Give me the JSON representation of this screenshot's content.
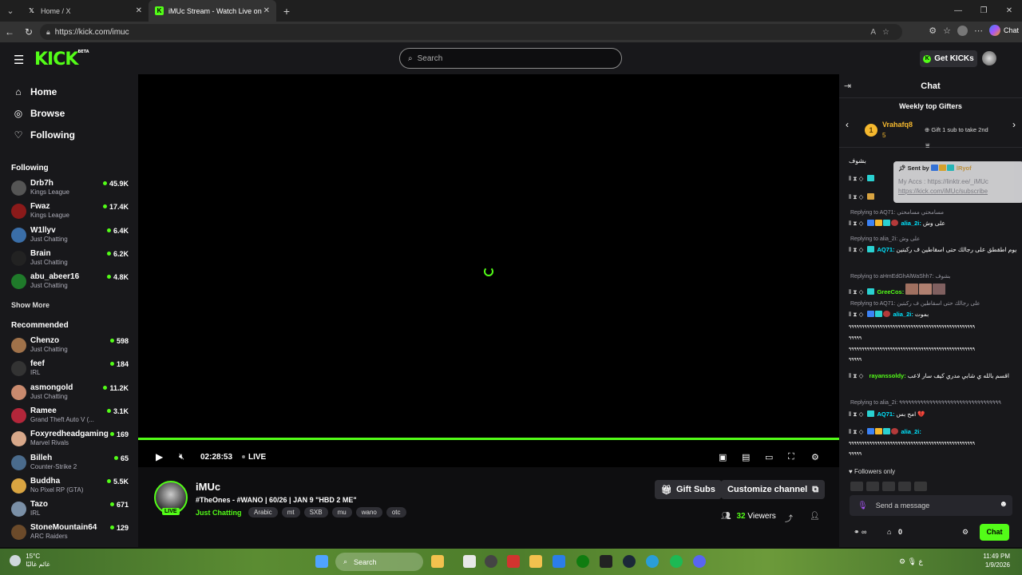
{
  "browser": {
    "tabs": [
      {
        "title": "Home / X",
        "icon": "x-icon",
        "active": false
      },
      {
        "title": "iMUc Stream - Watch Live on Kick",
        "icon": "kick-icon",
        "active": true
      }
    ],
    "url": "https://kick.com/imuc",
    "chat_label": "Chat"
  },
  "header": {
    "logo": "KICK",
    "logo_beta": "BETA",
    "search_placeholder": "Search",
    "get_kicks": "Get KICKs"
  },
  "sidebar": {
    "nav": [
      {
        "label": "Home",
        "icon": "home-icon"
      },
      {
        "label": "Browse",
        "icon": "compass-icon"
      },
      {
        "label": "Following",
        "icon": "heart-icon"
      }
    ],
    "following_title": "Following",
    "following": [
      {
        "name": "Drb7h",
        "category": "Kings League",
        "viewers": "45.9K",
        "color": "#555"
      },
      {
        "name": "Fwaz",
        "category": "Kings League",
        "viewers": "17.4K",
        "color": "#8b1a1a"
      },
      {
        "name": "W1llyv",
        "category": "Just Chatting",
        "viewers": "6.4K",
        "color": "#3a6ea8"
      },
      {
        "name": "Brain",
        "category": "Just Chatting",
        "viewers": "6.2K",
        "color": "#222"
      },
      {
        "name": "abu_abeer16",
        "category": "Just Chatting",
        "viewers": "4.8K",
        "color": "#1f7a2a"
      }
    ],
    "show_more": "Show More",
    "recommended_title": "Recommended",
    "recommended": [
      {
        "name": "Chenzo",
        "category": "Just Chatting",
        "viewers": "598",
        "color": "#a0724a"
      },
      {
        "name": "feef",
        "category": "IRL",
        "viewers": "184",
        "color": "#333"
      },
      {
        "name": "asmongold",
        "category": "Just Chatting",
        "viewers": "11.2K",
        "color": "#c98a6e"
      },
      {
        "name": "Ramee",
        "category": "Grand Theft Auto V (...",
        "viewers": "3.1K",
        "color": "#b3263a"
      },
      {
        "name": "Foxyredheadgaming",
        "category": "Marvel Rivals",
        "viewers": "169",
        "color": "#d8a88a"
      },
      {
        "name": "Billeh",
        "category": "Counter-Strike 2",
        "viewers": "65",
        "color": "#4a6b8c"
      },
      {
        "name": "Buddha",
        "category": "No Pixel RP (GTA)",
        "viewers": "5.5K",
        "color": "#d9a441"
      },
      {
        "name": "Tazo",
        "category": "IRL",
        "viewers": "671",
        "color": "#7a8fa6"
      },
      {
        "name": "StoneMountain64",
        "category": "ARC Raiders",
        "viewers": "129",
        "color": "#6b4a2a"
      }
    ]
  },
  "player": {
    "time": "02:28:53",
    "live": "LIVE",
    "progress": 1.0
  },
  "stream": {
    "name": "iMUc",
    "live_badge": "LIVE",
    "title": "#TheOnes - #WANO | 60/26 | JAN 9 \"HBD 2 ME\"",
    "category": "Just Chatting",
    "tags": [
      "Arabic",
      "mt",
      "SXB",
      "mu",
      "wano",
      "otc"
    ],
    "gift_subs": "Gift Subs",
    "customize": "Customize channel",
    "viewers_count": "32",
    "viewers_label": "Viewers"
  },
  "chat": {
    "title": "Chat",
    "gifters_title": "Weekly top Gifters",
    "top_gifter": {
      "rank": "1",
      "name": "Vrahafq8",
      "count": "5"
    },
    "gift_note": "Gift 1 sub to take 2nd",
    "tooltip": {
      "sent_by": "Sent by",
      "sender": "lRyof",
      "line1": "My Accs : https://linktr.ee/_iMUc",
      "line2": "https://kick.com/iMUc/subscribe"
    },
    "first_line": "بشوف",
    "messages": [
      {
        "reply": "",
        "user": "",
        "text": ""
      },
      {
        "reply": "Replying to AQ71: مسامحتي مسامحتي",
        "user": "alia_2i:",
        "text": "على وش",
        "color": "#00e5ff"
      },
      {
        "reply": "Replying to alia_2i: على وش",
        "user": "AQ71:",
        "text": "يوم اطقطق على رجالك حتى اسقاطين ف ركبتين",
        "color": "#00e5ff"
      },
      {
        "reply": "Replying to aHmEdGhAlWaShh7: بشوف",
        "user": "GreeCos:",
        "text": "",
        "color": "#53fc18"
      },
      {
        "reply": "Replying to AQ71: على رجالك حتى اسقاطين ف ركبتين",
        "user": "alia_2i:",
        "text": "بموت",
        "color": "#00e5ff"
      },
      {
        "reply": "",
        "user": "",
        "text": "٩٩٩٩٩٩٩٩٩٩٩٩٩٩٩٩٩٩٩٩٩٩٩٩٩٩٩٩٩٩٩٩٩٩٩٩٩٩٩٩٩٩٩٩٩٩٩"
      },
      {
        "reply": "",
        "user": "rayanssoldy:",
        "text": "اقسم بالله ي شابي مدري كيف سار لاعب",
        "color": "#53fc18"
      },
      {
        "reply": "Replying to alia_2i: ٩٩٩٩٩٩٩٩٩٩٩٩٩٩٩٩٩٩٩٩٩٩٩٩٩٩٩٩٩٩٩٩٩٩",
        "user": "AQ71:",
        "text": "امح بس 💔",
        "color": "#00e5ff"
      },
      {
        "reply": "",
        "user": "alia_2i:",
        "text": "",
        "color": "#00e5ff"
      }
    ],
    "spam_line": "٩٩٩٩٩٩٩٩٩٩٩٩٩٩٩٩٩٩٩٩٩٩٩٩٩٩٩٩٩٩٩٩٩٩٩٩٩٩٩٩٩٩٩٩٩٩٩٩٩",
    "spam_tail": "٩٩٩٩٩",
    "followers_only": "Followers only",
    "send_placeholder": "Send a message",
    "kicks_count": "0",
    "chat_button": "Chat"
  },
  "taskbar": {
    "temp": "15°C",
    "weather": "غائم غالبًا",
    "search": "Search",
    "time": "11:49 PM",
    "date": "1/9/2026"
  }
}
